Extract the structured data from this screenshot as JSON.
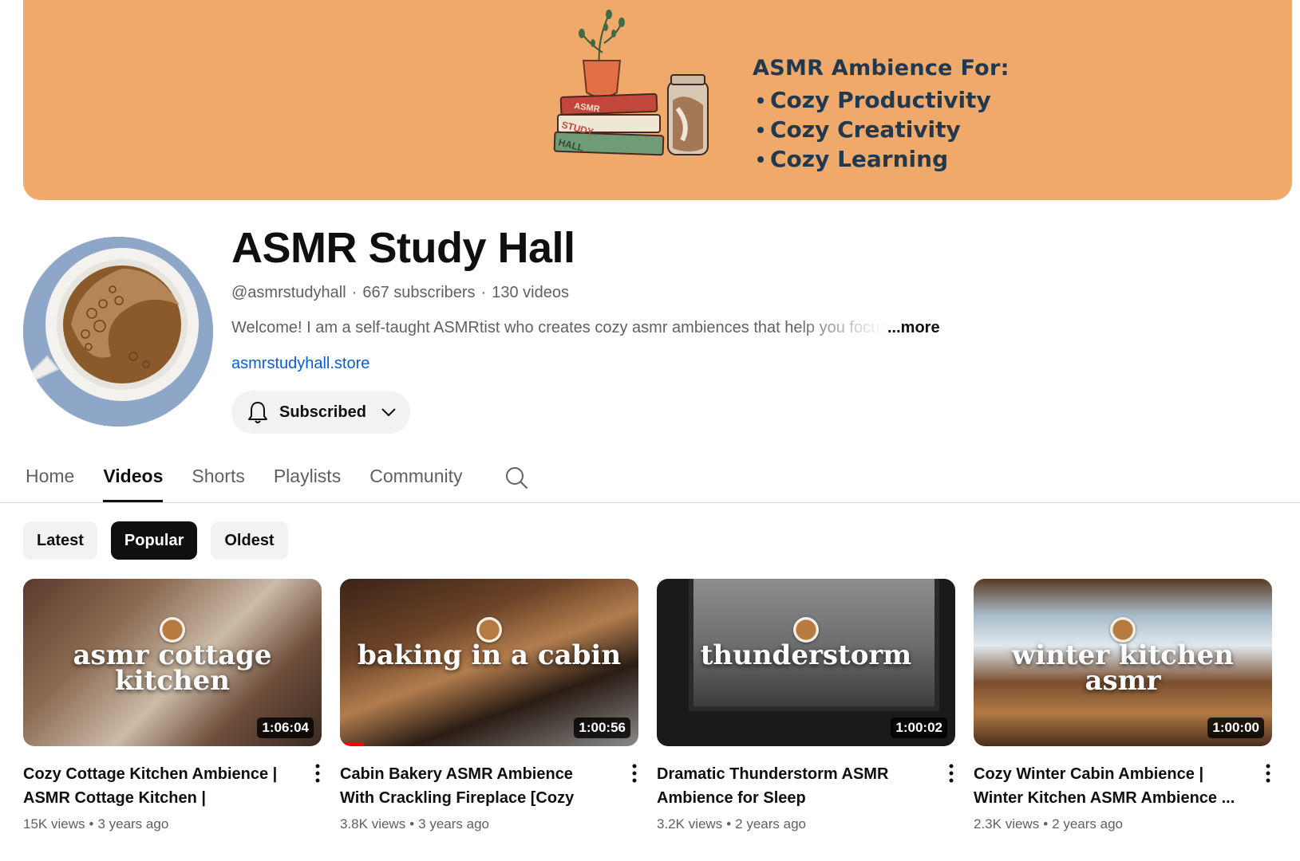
{
  "banner": {
    "book_labels": [
      "ASMR",
      "STUDY",
      "HALL"
    ],
    "heading": "ASMR Ambience For:",
    "lines": [
      "Cozy Productivity",
      "Cozy Creativity",
      "Cozy Learning"
    ],
    "color": "#efa96b"
  },
  "channel": {
    "name": "ASMR Study Hall",
    "handle": "@asmrstudyhall",
    "subscribers": "667 subscribers",
    "video_count": "130 videos",
    "description": "Welcome! I am a self-taught ASMRtist who creates cozy asmr ambiences that help you focus",
    "more_label": "...more",
    "link": "asmrstudyhall.store",
    "subscribe_label": "Subscribed"
  },
  "tabs": [
    {
      "label": "Home",
      "active": false
    },
    {
      "label": "Videos",
      "active": true
    },
    {
      "label": "Shorts",
      "active": false
    },
    {
      "label": "Playlists",
      "active": false
    },
    {
      "label": "Community",
      "active": false
    }
  ],
  "chips": [
    {
      "label": "Latest",
      "selected": false
    },
    {
      "label": "Popular",
      "selected": true
    },
    {
      "label": "Oldest",
      "selected": false
    }
  ],
  "videos": [
    {
      "thumb_text": "asmr cottage kitchen",
      "duration": "1:06:04",
      "title": "Cozy Cottage Kitchen Ambience | ASMR Cottage Kitchen | Relaxing...",
      "views": "15K views",
      "age": "3 years ago",
      "watched_fraction": 0
    },
    {
      "thumb_text": "baking in a cabin",
      "duration": "1:00:56",
      "title": "Cabin Bakery ASMR Ambience With Crackling Fireplace [Cozy Autumn...",
      "views": "3.8K views",
      "age": "3 years ago",
      "watched_fraction": 0.08
    },
    {
      "thumb_text": "thunderstorm",
      "duration": "1:00:02",
      "title": "Dramatic Thunderstorm ASMR Ambience for Sleep",
      "views": "3.2K views",
      "age": "2 years ago",
      "watched_fraction": 0
    },
    {
      "thumb_text": "winter kitchen asmr",
      "duration": "1:00:00",
      "title": "Cozy Winter Cabin Ambience | Winter Kitchen ASMR Ambience ...",
      "views": "2.3K views",
      "age": "2 years ago",
      "watched_fraction": 0
    }
  ]
}
